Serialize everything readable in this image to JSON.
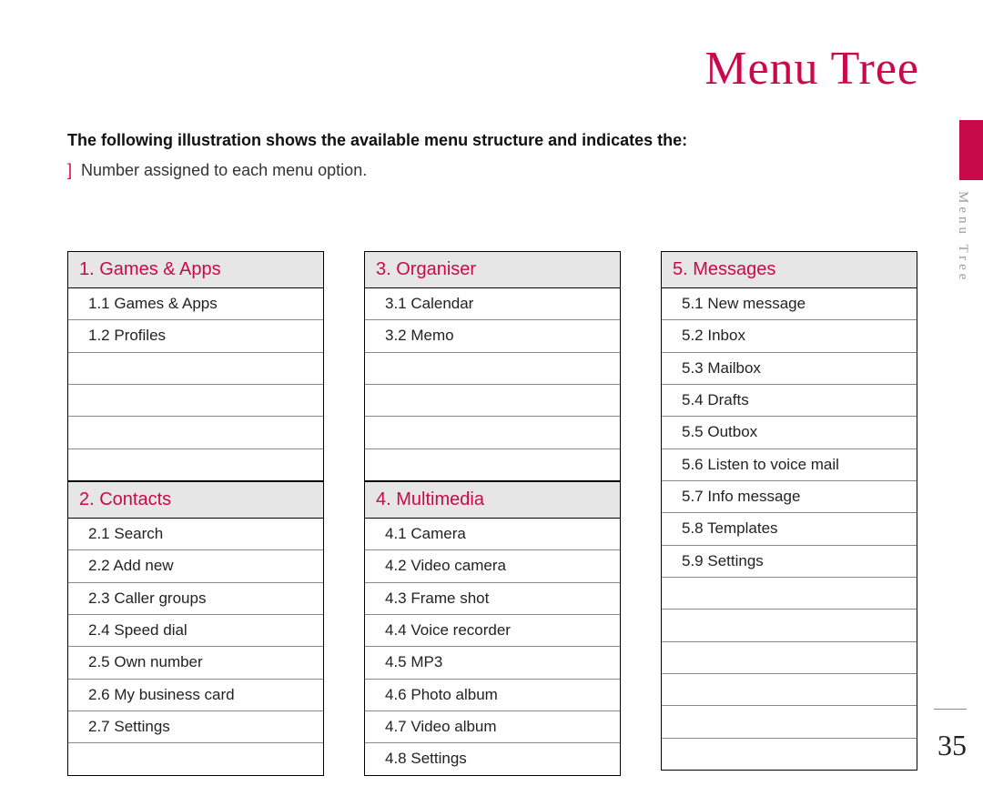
{
  "title": "Menu Tree",
  "side_label": "Menu Tree",
  "intro_bold": "The following illustration shows the available menu structure and indicates the:",
  "intro_bullet": "Number assigned to each menu option.",
  "page_number": "35",
  "columns": [
    [
      {
        "header": "1. Games & Apps",
        "items": [
          "1.1 Games & Apps",
          "1.2 Profiles"
        ],
        "pad_rows": 4
      },
      {
        "header": "2. Contacts",
        "items": [
          "2.1 Search",
          "2.2 Add new",
          "2.3 Caller groups",
          "2.4 Speed dial",
          "2.5 Own number",
          "2.6 My business card",
          "2.7 Settings"
        ],
        "pad_rows": 1
      }
    ],
    [
      {
        "header": "3. Organiser",
        "items": [
          "3.1 Calendar",
          "3.2 Memo"
        ],
        "pad_rows": 4
      },
      {
        "header": "4. Multimedia",
        "items": [
          "4.1 Camera",
          "4.2 Video camera",
          "4.3 Frame shot",
          "4.4 Voice recorder",
          "4.5 MP3",
          "4.6 Photo album",
          "4.7 Video album",
          "4.8 Settings"
        ],
        "pad_rows": 0
      }
    ],
    [
      {
        "header": "5. Messages",
        "items": [
          "5.1 New message",
          "5.2 Inbox",
          "5.3 Mailbox",
          "5.4 Drafts",
          "5.5 Outbox",
          "5.6 Listen to voice mail",
          "5.7 Info message",
          "5.8 Templates",
          "5.9 Settings"
        ],
        "pad_rows": 6
      }
    ]
  ]
}
